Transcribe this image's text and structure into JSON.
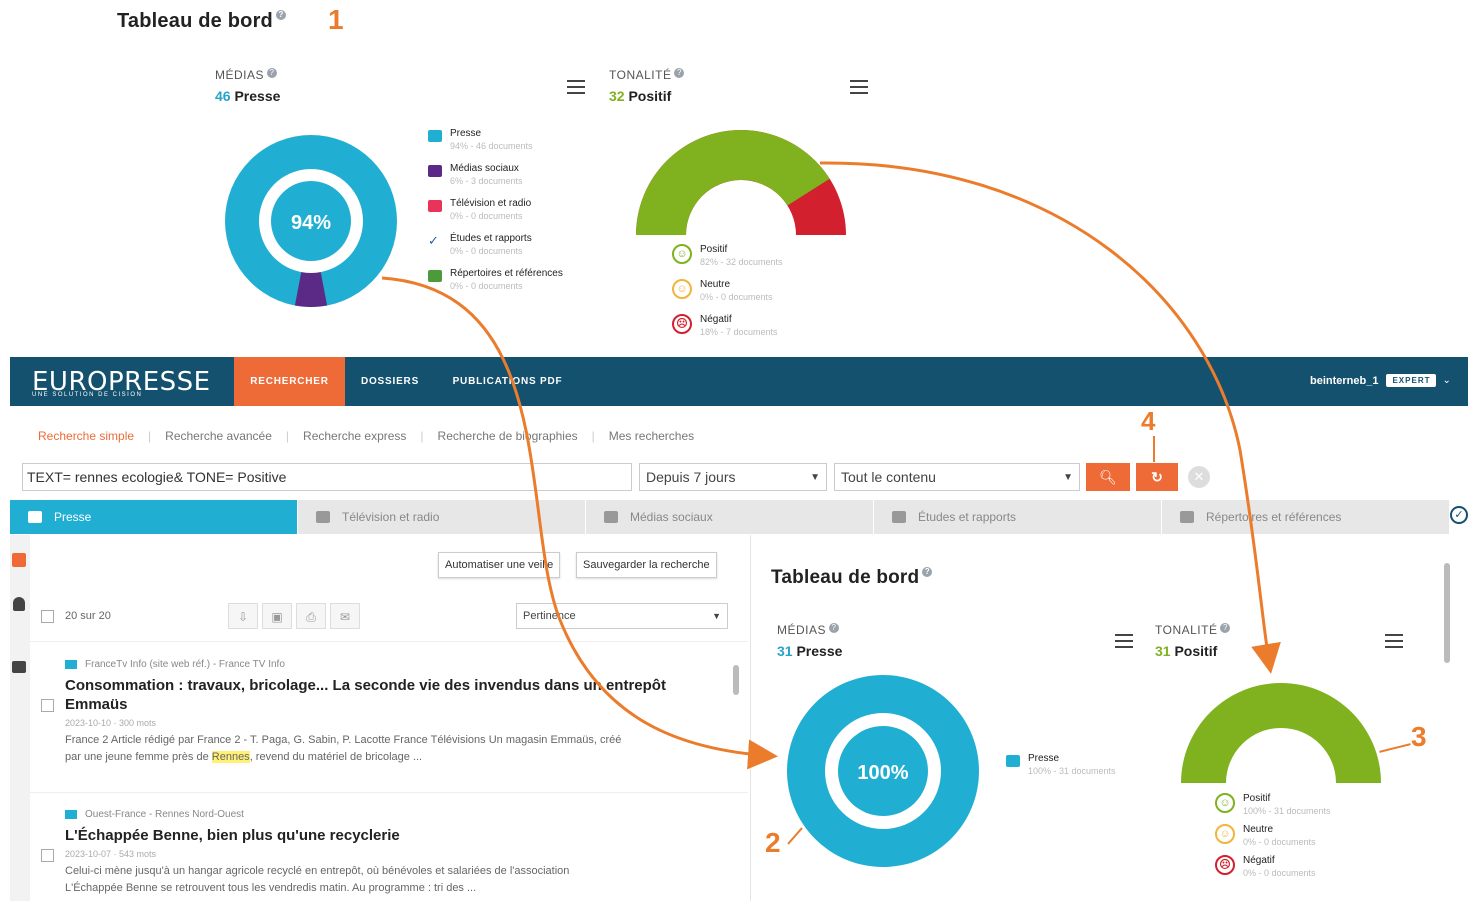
{
  "top_dashboard": {
    "title": "Tableau de bord",
    "step_label": "1",
    "medias": {
      "label": "MÉDIAS",
      "count": "46",
      "type": "Presse",
      "donut_pct": "94%",
      "donut_fraction": 0.94,
      "legend": [
        {
          "name": "Presse",
          "sub": "94% - 46 documents",
          "color": "#20afd2",
          "icon": "newspaper-icon"
        },
        {
          "name": "Médias sociaux",
          "sub": "6% - 3 documents",
          "color": "#5b2a86",
          "icon": "social-icon"
        },
        {
          "name": "Télévision et radio",
          "sub": "0% - 0 documents",
          "color": "#e8345a",
          "icon": "tv-icon"
        },
        {
          "name": "Études et rapports",
          "sub": "0% - 0 documents",
          "color": "#2d5ca8",
          "icon": "chart-icon"
        },
        {
          "name": "Répertoires et références",
          "sub": "0% - 0 documents",
          "color": "#4c9a3a",
          "icon": "book-icon"
        }
      ]
    },
    "tonalite": {
      "label": "TONALITÉ",
      "count": "32",
      "type": "Positif",
      "gauge_pct": "82%",
      "gauge_fraction": 0.82,
      "legend": [
        {
          "name": "Positif",
          "sub": "82% - 32 documents",
          "color": "#7fb21e",
          "face": "☺"
        },
        {
          "name": "Neutre",
          "sub": "0% - 0 documents",
          "color": "#f2b43a",
          "face": "☺"
        },
        {
          "name": "Négatif",
          "sub": "18% - 7 documents",
          "color": "#d2202f",
          "face": "☹"
        }
      ]
    }
  },
  "app": {
    "logo": "EUROPRESSE",
    "logo_sub": "UNE SOLUTION DE CISION",
    "nav": [
      "RECHERCHER",
      "DOSSIERS",
      "PUBLICATIONS PDF"
    ],
    "user": "beinterneb_1",
    "badge": "EXPERT",
    "subnav": [
      "Recherche simple",
      "Recherche avancée",
      "Recherche express",
      "Recherche de biographies",
      "Mes recherches"
    ],
    "step4": "4",
    "search_value": "TEXT= rennes ecologie& TONE= Positive",
    "period": "Depuis 7 jours",
    "scope": "Tout le contenu",
    "tabs": [
      "Presse",
      "Télévision et radio",
      "Médias sociaux",
      "Études et rapports",
      "Répertoires et références"
    ],
    "automate_btn": "Automatiser une veille",
    "save_btn": "Sauvegarder la recherche",
    "count_label": "20 sur 20",
    "sort": "Pertinence",
    "articles": [
      {
        "source": "FranceTv Info (site web réf.) - France TV Info",
        "title_line1": "Consommation : travaux, bricolage... La seconde vie des invendus dans un entrepôt",
        "title_line2": "Emmaüs",
        "meta": "2023-10-10  ·  300 mots",
        "text_line1": "France 2 Article rédigé par France 2 - T. Paga, G. Sabin, P. Lacotte France Télévisions Un magasin Emmaüs, créé",
        "text_pre": "par une jeune femme près de ",
        "text_hl": "Rennes",
        "text_post": ", revend du matériel de bricolage ..."
      },
      {
        "source": "Ouest-France - Rennes Nord-Ouest",
        "title_line1": "L'Échappée Benne, bien plus qu'une recyclerie",
        "meta": "2023-10-07  ·  543 mots",
        "text_line1": "Celui-ci mène jusqu'à un hangar agricole recyclé en entrepôt, où bénévoles et salariées de l'association",
        "text_line2": "L'Échappée Benne se retrouvent tous les vendredis matin. Au programme : tri des ..."
      }
    ],
    "right_dashboard": {
      "title": "Tableau de bord",
      "medias_label": "MÉDIAS",
      "medias_count": "31",
      "medias_type": "Presse",
      "donut_pct": "100%",
      "donut_fraction": 1.0,
      "legend_name": "Presse",
      "legend_sub": "100% - 31 documents",
      "ton_label": "TONALITÉ",
      "ton_count": "31",
      "ton_type": "Positif",
      "gauge_pct": "100%",
      "gauge_fraction": 1.0,
      "ton_legend": [
        {
          "name": "Positif",
          "sub": "100% - 31 documents",
          "color": "#7fb21e",
          "face": "☺"
        },
        {
          "name": "Neutre",
          "sub": "0% - 0 documents",
          "color": "#f2b43a",
          "face": "☺"
        },
        {
          "name": "Négatif",
          "sub": "0% - 0 documents",
          "color": "#d2202f",
          "face": "☹"
        }
      ],
      "step2": "2",
      "step3": "3"
    }
  },
  "colors": {
    "accent": "#ee6b37",
    "navy": "#13516e",
    "cyan": "#20afd2",
    "green": "#7fb21e",
    "red": "#d2202f",
    "purple": "#5b2a86"
  }
}
